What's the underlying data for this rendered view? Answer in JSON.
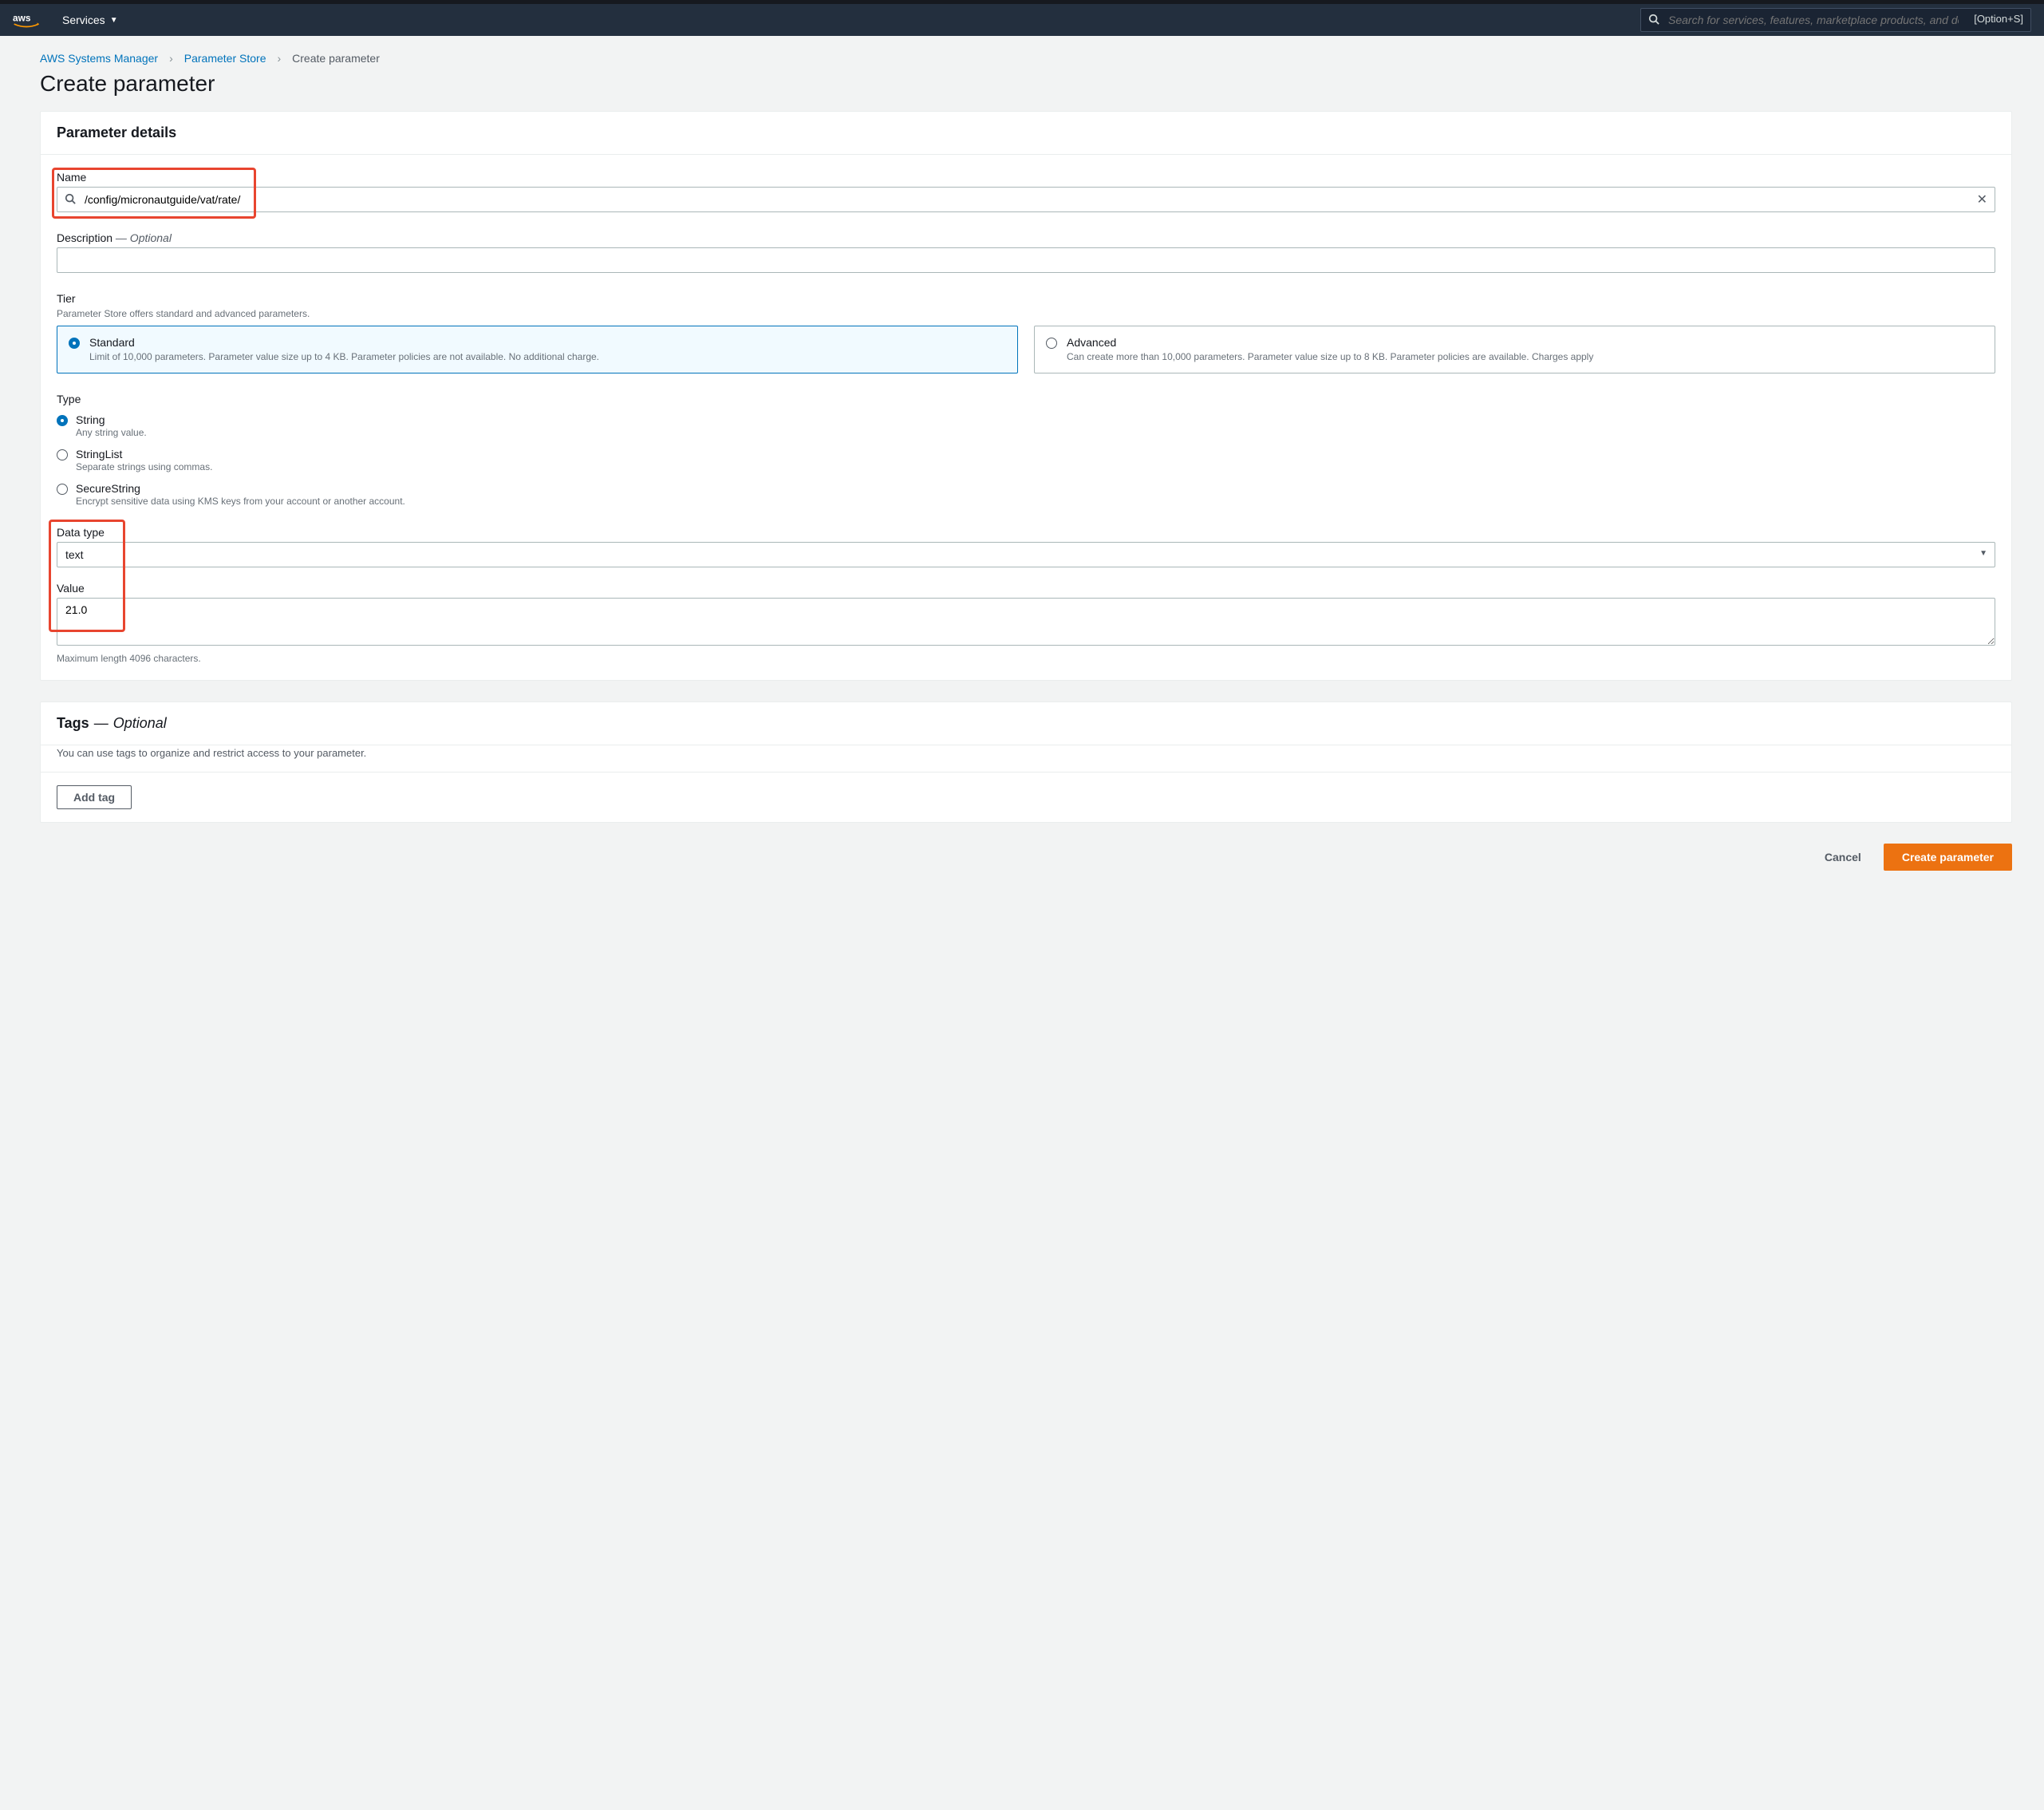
{
  "topbar": {
    "services_label": "Services",
    "search_placeholder": "Search for services, features, marketplace products, and docs",
    "shortcut": "[Option+S]"
  },
  "breadcrumbs": {
    "items": [
      "AWS Systems Manager",
      "Parameter Store",
      "Create parameter"
    ]
  },
  "page_title": "Create parameter",
  "details_panel": {
    "header": "Parameter details",
    "name": {
      "label": "Name",
      "value": "/config/micronautguide/vat/rate/"
    },
    "description": {
      "label": "Description",
      "optional": "— Optional",
      "value": ""
    },
    "tier": {
      "label": "Tier",
      "hint": "Parameter Store offers standard and advanced parameters.",
      "options": [
        {
          "title": "Standard",
          "desc": "Limit of 10,000 parameters. Parameter value size up to 4 KB. Parameter policies are not available. No additional charge.",
          "selected": true
        },
        {
          "title": "Advanced",
          "desc": "Can create more than 10,000 parameters. Parameter value size up to 8 KB. Parameter policies are available. Charges apply",
          "selected": false
        }
      ]
    },
    "type": {
      "label": "Type",
      "options": [
        {
          "title": "String",
          "desc": "Any string value.",
          "selected": true
        },
        {
          "title": "StringList",
          "desc": "Separate strings using commas.",
          "selected": false
        },
        {
          "title": "SecureString",
          "desc": "Encrypt sensitive data using KMS keys from your account or another account.",
          "selected": false
        }
      ]
    },
    "data_type": {
      "label": "Data type",
      "value": "text"
    },
    "value": {
      "label": "Value",
      "value": "21.0",
      "hint": "Maximum length 4096 characters."
    }
  },
  "tags_panel": {
    "header": "Tags",
    "dash": "—",
    "optional": "Optional",
    "desc": "You can use tags to organize and restrict access to your parameter.",
    "add_btn": "Add tag"
  },
  "footer": {
    "cancel": "Cancel",
    "create": "Create parameter"
  }
}
